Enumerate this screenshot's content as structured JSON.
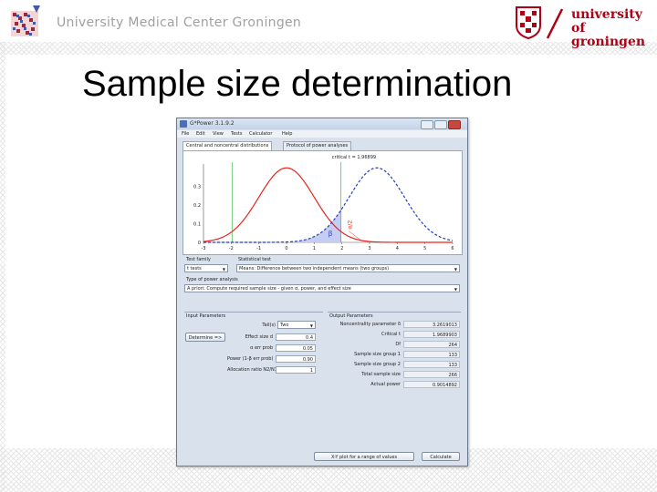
{
  "header": {
    "left_text": "University Medical Center Groningen",
    "right_text_line1": "university of",
    "right_text_line2": "groningen"
  },
  "slide": {
    "title": "Sample size determination"
  },
  "window": {
    "title": "G*Power 3.1.9.2",
    "menu": [
      "File",
      "Edit",
      "View",
      "Tests",
      "Calculator",
      "Help"
    ],
    "tabs": [
      "Central and noncentral distributions",
      "Protocol of power analyses"
    ],
    "plot": {
      "critical_label": "critical t = 1.96899",
      "y_ticks": [
        "0.3",
        "0.2",
        "0.1",
        "0"
      ],
      "x_ticks": [
        "-3",
        "-2",
        "-1",
        "0",
        "1",
        "2",
        "3",
        "4",
        "5",
        "6"
      ],
      "beta_symbol": "β",
      "alpha_symbol": "α",
      "colors": {
        "central": "#e8231d",
        "noncentral": "#1f3ec8",
        "critical": "#39b54a",
        "beta_fill": "#c6cdf2"
      }
    },
    "test_family": {
      "label": "Test family",
      "value": "t tests"
    },
    "statistical_test": {
      "label": "Statistical test",
      "value": "Means: Difference between two independent means (two groups)"
    },
    "analysis_type": {
      "label": "Type of power analysis",
      "value": "A priori: Compute required sample size - given α, power, and effect size"
    },
    "input": {
      "title": "Input Parameters",
      "determine_button": "Determine =>",
      "tails_label": "Tail(s)",
      "tails_value": "Two",
      "rows": [
        {
          "label": "Effect size d",
          "value": "0.4"
        },
        {
          "label": "α err prob",
          "value": "0.05"
        },
        {
          "label": "Power (1-β err prob)",
          "value": "0.90"
        },
        {
          "label": "Allocation ratio N2/N1",
          "value": "1"
        }
      ]
    },
    "output": {
      "title": "Output Parameters",
      "rows": [
        {
          "label": "Noncentrality parameter δ",
          "value": "3.2619013"
        },
        {
          "label": "Critical t",
          "value": "1.9689903"
        },
        {
          "label": "Df",
          "value": "264"
        },
        {
          "label": "Sample size group 1",
          "value": "133"
        },
        {
          "label": "Sample size group 2",
          "value": "133"
        },
        {
          "label": "Total sample size",
          "value": "266"
        },
        {
          "label": "Actual power",
          "value": "0.9014892"
        }
      ]
    },
    "buttons": {
      "xy_plot": "X-Y plot for a range of values",
      "calculate": "Calculate"
    }
  }
}
